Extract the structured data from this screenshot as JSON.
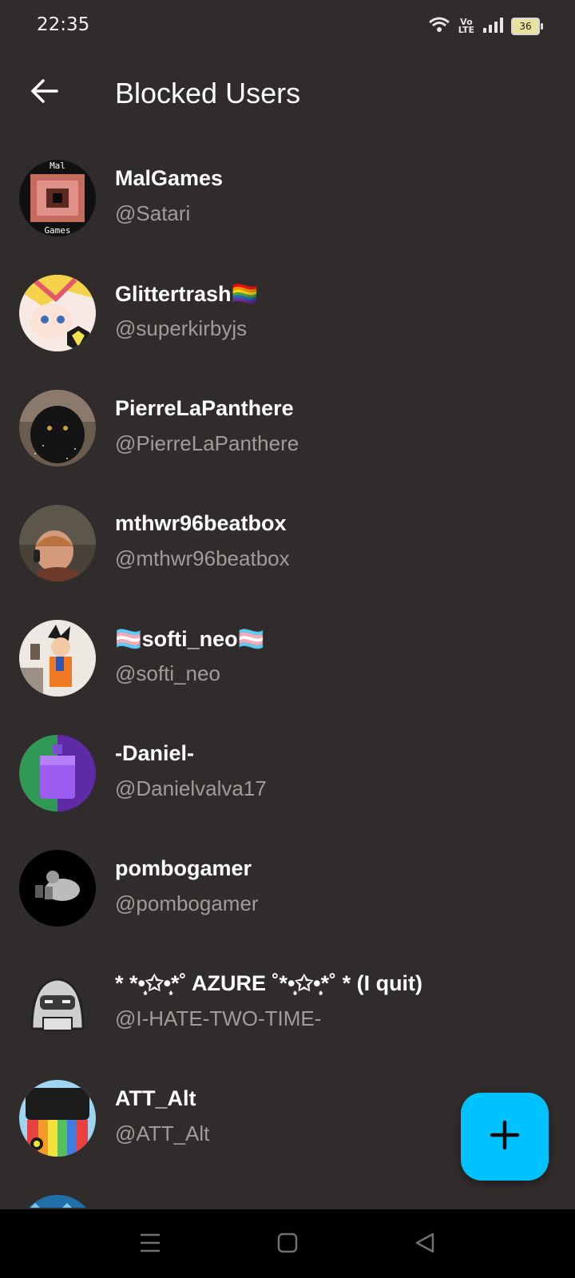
{
  "status_bar": {
    "time": "22:35",
    "volte_top": "Vo",
    "volte_bottom": "LTE",
    "battery": "36"
  },
  "app_bar": {
    "title": "Blocked Users"
  },
  "users": [
    {
      "display_name": "MalGames",
      "username": "@Satari",
      "avatar_text_top": "Mal",
      "avatar_text_bottom": "Games"
    },
    {
      "display_name": "Glittertrash🏳️‍🌈",
      "username": "@superkirbyjs"
    },
    {
      "display_name": "PierreLaPanthere",
      "username": "@PierreLaPanthere"
    },
    {
      "display_name": "mthwr96beatbox",
      "username": "@mthwr96beatbox"
    },
    {
      "display_name": "🏳️‍⚧️softi_neo🏳️‍⚧️",
      "username": "@softi_neo"
    },
    {
      "display_name": "-Daniel-",
      "username": "@Danielvalva17"
    },
    {
      "display_name": "pombogamer",
      "username": "@pombogamer"
    },
    {
      "display_name": " * *•̩̩͙✩•̩̩͙*˚ AZURE ˚*•̩̩͙✩•̩̩͙*˚ * (I quit)",
      "username": "@I-HATE-TWO-TIME-"
    },
    {
      "display_name": "ATT_Alt",
      "username": "@ATT_Alt"
    }
  ],
  "fab": {
    "icon": "plus-icon",
    "color": "#00c2ff"
  },
  "colors": {
    "background": "#302c2b",
    "secondary_text": "#a19c9a",
    "accent": "#00c2ff"
  }
}
